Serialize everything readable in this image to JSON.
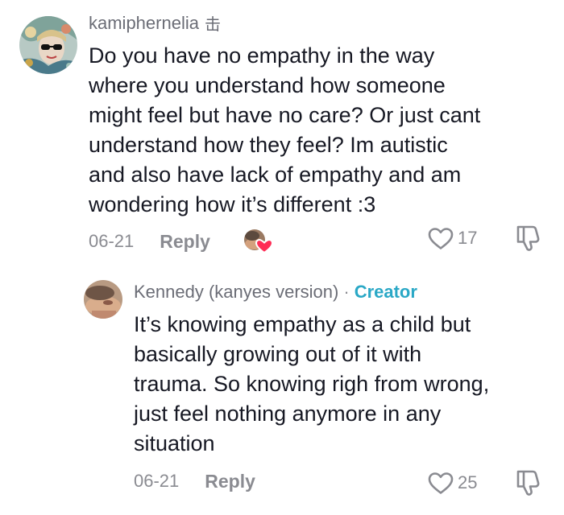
{
  "comments": [
    {
      "username": "kamiphernelia",
      "user_badge": "击",
      "text_lines": [
        "Do you have no empathy in the way",
        "where you understand how someone",
        "might feel but have no care? Or just cant",
        "understand how they feel? Im autistic",
        "and also have lack of empathy and am",
        "wondering how it’s different :3"
      ],
      "date": "06-21",
      "reply_label": "Reply",
      "like_count": "17",
      "creator_liked": true
    },
    {
      "username": "Kennedy (kanyes version)",
      "separator": "·",
      "creator_label": "Creator",
      "text_lines": [
        "It’s knowing empathy as a child but",
        "basically growing out of it with",
        "trauma. So knowing righ from wrong,",
        "just feel nothing anymore in any",
        "situation"
      ],
      "date": "06-21",
      "reply_label": "Reply",
      "like_count": "25"
    }
  ],
  "colors": {
    "text": "#161823",
    "muted": "#8a8b91",
    "creator_accent": "#2aa8c6",
    "like_heart_badge": "#fe2c55"
  },
  "icons": {
    "like": "heart-outline-icon",
    "dislike": "thumbs-down-outline-icon",
    "creator_like": "creator-liked-heart-icon"
  }
}
